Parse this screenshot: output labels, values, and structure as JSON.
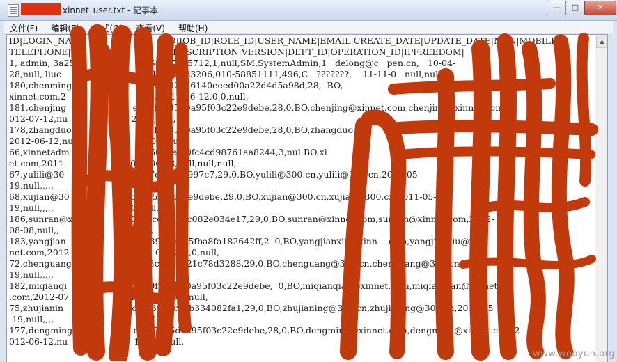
{
  "window": {
    "file_name": "xinnet_user.txt - 记事本",
    "buttons": {
      "minimize": "—",
      "maximize": "□",
      "close": "✕"
    }
  },
  "menu": {
    "items": [
      "文件(F)",
      "编辑(E)",
      "格式(O)",
      "查看(V)",
      "帮助(H)"
    ]
  },
  "editor": {
    "lines": [
      "ID|LOGIN_NAM                                D|JOB_ID|ROLE_ID|USER_NAME|EMAIL|CREATE_DATE|UPDATE_DATE|MSN|MOBILE|",
      "TELEPHONE|OF                               |DESCRIPTION|VERSION|DEPT_ID|OPERATION_ID|IPFREEDOM|",
      "1, admin, 3a25                           58817ce5712,1,null,SM,SystemAdmin,1   delong@c   pen.cn,   10-04-",
      "28,null, liuc                         com,13641033206,010-58851111,496,C   ???????,    11-11-0   null,null,1,",
      "180,chenming                         ded3882ad6140eeed00a22d4d5a98d,28,  BO,                           ing@",
      "xinnet.com,2                           CA,,2012-06-12,0,0,null,",
      "181,chenjing                        ede9f2735d0a95f03c22e9debe,28,0,BO,chenjing@xinnet.com,chenjing@xinnet.com,2",
      "012-07-12,nu                       2,0,0,null,",
      "178,zhangduo                        de9f2735d0a95f03c22e9debe,28,0,BO,zhangduo                                ",
      "2012-06-12,nu                         2,0,0,null,",
      "66,xinnetadm                         d76664ef10fc4cd98761aa8244,3,nul BO,xi                            xinn",
      "et.com,2011-                      ,012-06-18,null,null,null,",
      "67,yulili@30                     ba37c7d078be997c7,29,0,BO,yulili@300.cn,yulili@300.cn,2011-05-",
      "19,null,,,,,                        2,0,0,null,",
      "68,xujian@30                      d0a95f03c22e9debe,29,0,BO,xujian@300.cn,xujian@300.cn,2011-05-",
      "19,null,,,,,                        ,0,0,null,",
      "186,sunran@x                     0adccc6f995c082e034e17,29,0,BO,sunran@xinnet.com,sunran@xinnet.com,2012-",
      "08-08,null,,                       ,0,null,",
      "183,yangjian                     8257f3905b685fba8fa182642ff,2  0,BO,yangjianxiu@xinn    com,yangjianxiu@xin",
      "net.com,2012                      2012-07-13,0,0,null,",
      "72,chenguang                      e423ce083121c78d3288,29,0,BO,chenguang@300.cn,chenguang@300.cn,2011-",
      "19,null,,,,,                        ,0,null,",
      "182,miqianqi                      0ede9f2735d0a95f03c22e9debe,  0,BO,miqianqian@xinnet.com,miqianqian@xinnet",
      ".com,2012-07                      12-07-12,0,0,null,",
      "75,zhujianin                     c1c97f3957ca0b334082fa1,29,0,BO,zhujianing@300.cn,zhujianing@300.cn,2011-05",
      "-19,null,,,,                     06      null,",
      "177,dengming                      de9f2735d0a95f03c22e9debe,28,0,BO,dengming@xinnet.com,dengming@xinnet.com,2",
      "012-06-12,nu                        12,0,0,null,"
    ]
  },
  "watermark": "www.wooyun.org",
  "colors": {
    "redaction": "#c23a0c",
    "title_redaction": "#e0300f"
  }
}
